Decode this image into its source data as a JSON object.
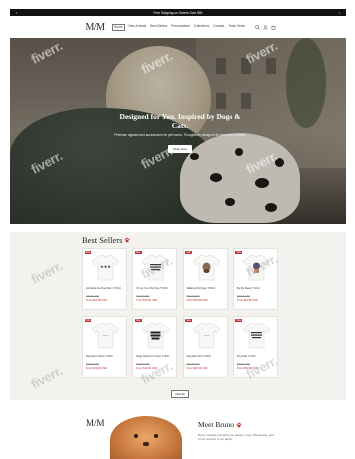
{
  "announcement": {
    "text": "Free Shipping on Orders Over $50",
    "prev": "‹",
    "next": "›"
  },
  "header": {
    "logo": "M/M",
    "nav": [
      "Home",
      "New Arrivals",
      "Best Sellers",
      "Personalized",
      "Collections",
      "Contact",
      "Track Order"
    ],
    "icons": [
      "search-icon",
      "account-icon",
      "cart-icon"
    ]
  },
  "hero": {
    "title_line1": "Designed for You. Inspired by Dogs &",
    "title_line2": "Cats.",
    "subtitle": "Premium apparel and accessories for pet lovers. Thoughtfully designed for everyday comfort.",
    "button": "Shop Now"
  },
  "bestsellers": {
    "title": "Best Sellers",
    "view_all": "View All",
    "products": [
      {
        "badge": "Sale",
        "name": "All About the Dog Mom T-Shirt",
        "old": "$29.99 USD",
        "price": "From $19.99 USD",
        "print": "stars"
      },
      {
        "badge": "Sale",
        "name": "I'd Let Your Pet Dog T-Shirt",
        "old": "$29.99 USD",
        "price": "From $19.99 USD",
        "print": "text"
      },
      {
        "badge": "Sale",
        "name": "Walking My Dogs T-Shirt",
        "old": "$29.99 USD",
        "price": "From $19.99 USD",
        "print": "dog"
      },
      {
        "badge": "Sale",
        "name": "Be My Daisy T-Shirt",
        "old": "$29.99 USD",
        "price": "From $19.99 USD",
        "print": "girl"
      },
      {
        "badge": "Sale",
        "name": "Dog Mom Vibes T-Shirt",
        "old": "$29.99 USD",
        "price": "From $19.99 USD",
        "print": "script"
      },
      {
        "badge": "Sale",
        "name": "Dogs Hair Don't Care T-Shirt",
        "old": "$29.99 USD",
        "price": "From $19.99 USD",
        "print": "bold"
      },
      {
        "badge": "Sale",
        "name": "Dog Mom Era T-Shirt",
        "old": "$29.99 USD",
        "price": "From $19.99 USD",
        "print": "script"
      },
      {
        "badge": "Sale",
        "name": "Dog Dad T-Shirt",
        "old": "$29.99 USD",
        "price": "From $19.99 USD",
        "print": "text"
      }
    ]
  },
  "meet": {
    "logo": "M/M",
    "title": "Meet Bruno",
    "text": "Bruno inspired everything we design. Loyal, affectionate, and a true member of our family."
  },
  "watermark": "fiverr.",
  "colors": {
    "accent": "#c2272d",
    "section_bg": "#f3f2ef",
    "announcement_bg": "#111111"
  }
}
